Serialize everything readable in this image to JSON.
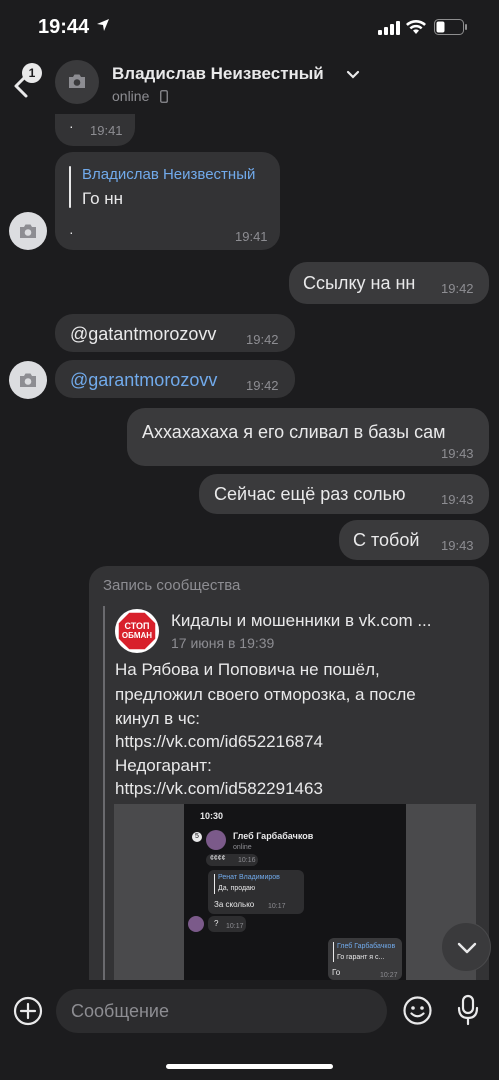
{
  "status_bar": {
    "time": "19:44"
  },
  "header": {
    "back_badge": "1",
    "contact_name": "Владислав Неизвестный",
    "presence": "online"
  },
  "messages": [
    {
      "id": "m0",
      "direction": "in",
      "text": "·",
      "time": "19:41"
    },
    {
      "id": "m1",
      "direction": "in",
      "reply_to_name": "Владислав Неизвестный",
      "reply_text": "Го нн",
      "text": "·",
      "time": "19:41"
    },
    {
      "id": "m2",
      "direction": "out",
      "text": "Ссылку на нн",
      "time": "19:42"
    },
    {
      "id": "m3",
      "direction": "in",
      "text": "@gatantmorozovv",
      "time": "19:42"
    },
    {
      "id": "m4",
      "direction": "in",
      "text": "@garantmorozovv",
      "time": "19:42",
      "is_link": true
    },
    {
      "id": "m5",
      "direction": "out",
      "text": "Аххахахаха я его сливал в базы сам",
      "time": "19:43"
    },
    {
      "id": "m6",
      "direction": "out",
      "text": "Сейчас ещё раз солью",
      "time": "19:43"
    },
    {
      "id": "m7",
      "direction": "out",
      "text": "С тобой",
      "time": "19:43"
    }
  ],
  "forwarded_post": {
    "label": "Запись сообщества",
    "community": "Кидалы и мошенники в vk.com ...",
    "logo_text_top": "СТОП",
    "logo_text_bottom": "ОБМАН",
    "date": "17 июня в 19:39",
    "lines": [
      {
        "text": "На Рябова и Поповича не пошёл,",
        "link": false
      },
      {
        "text": "предложил своего отморозка, а после",
        "link": false
      },
      {
        "text": "кинул в чс:",
        "link": false
      },
      {
        "text": "https://vk.com/id652216874",
        "link": true
      },
      {
        "text": "Недогарант:",
        "link": false
      },
      {
        "text": "https://vk.com/id582291463",
        "link": true
      }
    ],
    "preview": {
      "time": "10:30",
      "badge": "5",
      "name": "Глеб Гарбабачков",
      "presence": "online",
      "m1": "¢¢¢¢",
      "m1_time": "10:16",
      "reply_name": "Ренат Владимиров",
      "reply_text": "Да, продаю",
      "m2": "За сколько",
      "m2_time": "10:17",
      "m3": "?",
      "m3_time": "10:17",
      "reply2_name": "Глеб Гарбабачков",
      "reply2_text": "Го гарант я с...",
      "m4": "Го",
      "m4_time": "10:27"
    }
  },
  "composer": {
    "placeholder": "Сообщение"
  },
  "colors": {
    "background": "#1c1c1e",
    "bubble": "#333335",
    "link": "#71aaeb",
    "text": "#e9e9ea",
    "muted": "#8d8d92"
  },
  "icons": [
    "location-arrow-icon",
    "signal-icon",
    "wifi-icon",
    "battery-icon",
    "back-chevron-icon",
    "camera-icon",
    "chevron-down-icon",
    "phone-icon",
    "plus-icon",
    "emoji-icon",
    "mic-icon",
    "arrow-down-icon"
  ]
}
